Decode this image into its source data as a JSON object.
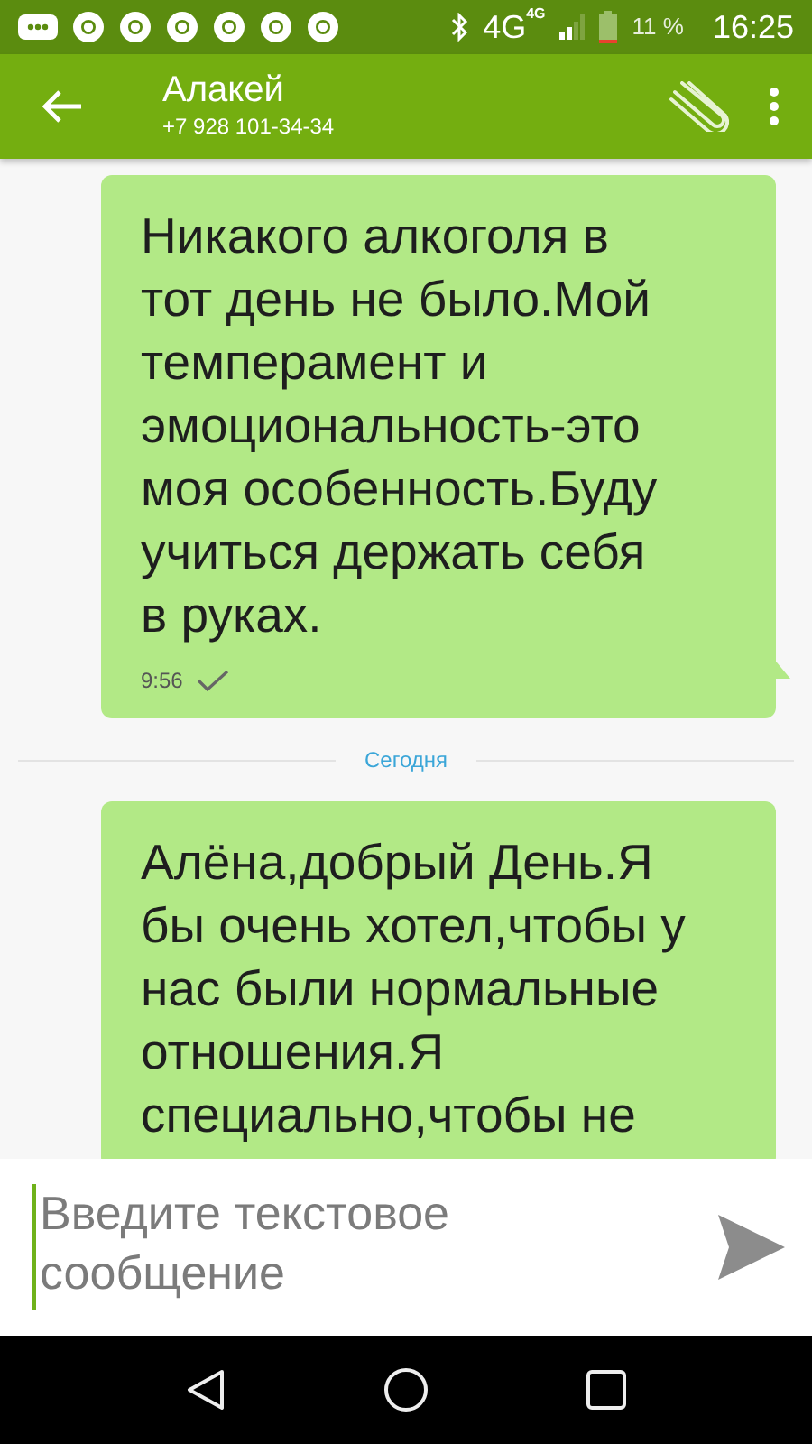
{
  "status_bar": {
    "network": "4G",
    "network_badge": "4G",
    "battery": "11 %",
    "time": "16:25"
  },
  "header": {
    "title": "Алакей",
    "subtitle": "+7 928 101-34-34"
  },
  "messages": [
    {
      "lines": [
        "Никакого алкоголя в",
        "тот день не было.Мой",
        "темперамент и",
        "эмоциональность-это",
        "моя особенность.Буду",
        "учиться держать себя",
        "в руках."
      ],
      "time": "9:56"
    },
    {
      "divider": "Сегодня"
    },
    {
      "lines": [
        "Алёна,добрый День.Я",
        "бы очень хотел,чтобы у",
        "нас были нормальные",
        "отношения.Я",
        "специально,чтобы не"
      ]
    }
  ],
  "composer": {
    "placeholder": "Введите текстовое сообщение"
  }
}
